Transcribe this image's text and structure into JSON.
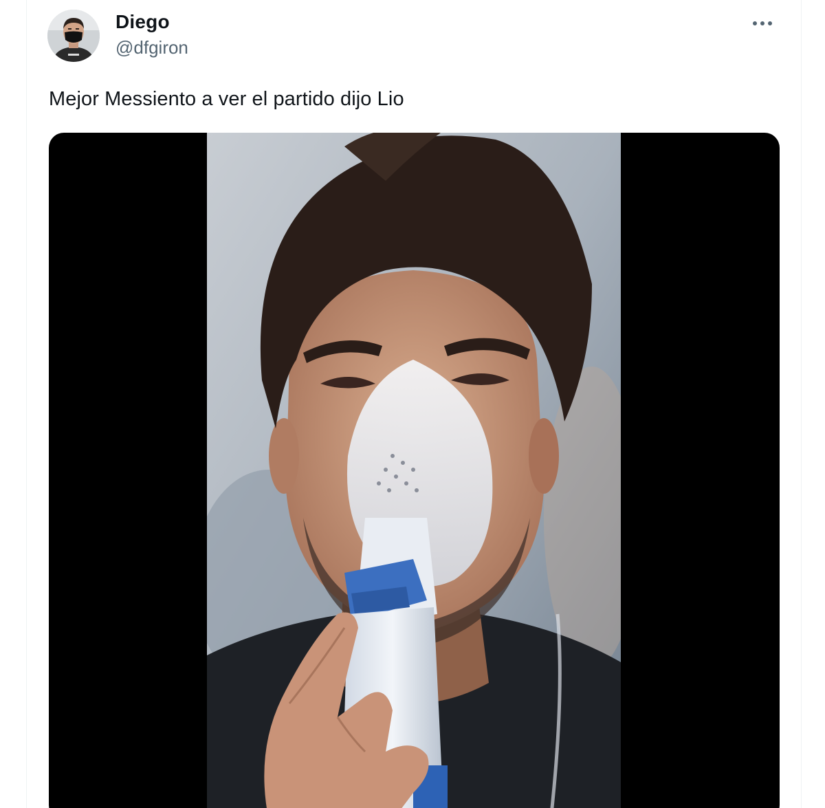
{
  "tweet": {
    "author_name": "Diego",
    "author_handle": "@dfgiron",
    "text": "Mejor Messiento a ver el partido dijo Lio"
  },
  "icons": {
    "avatar": "profile-photo",
    "more": "more-horizontal-icon"
  },
  "media": {
    "type": "video",
    "subject": "man-with-nebulizer-mask"
  },
  "colors": {
    "text_primary": "#0f1419",
    "text_secondary": "#536471",
    "media_background": "#000000",
    "border": "#eff3f4"
  }
}
